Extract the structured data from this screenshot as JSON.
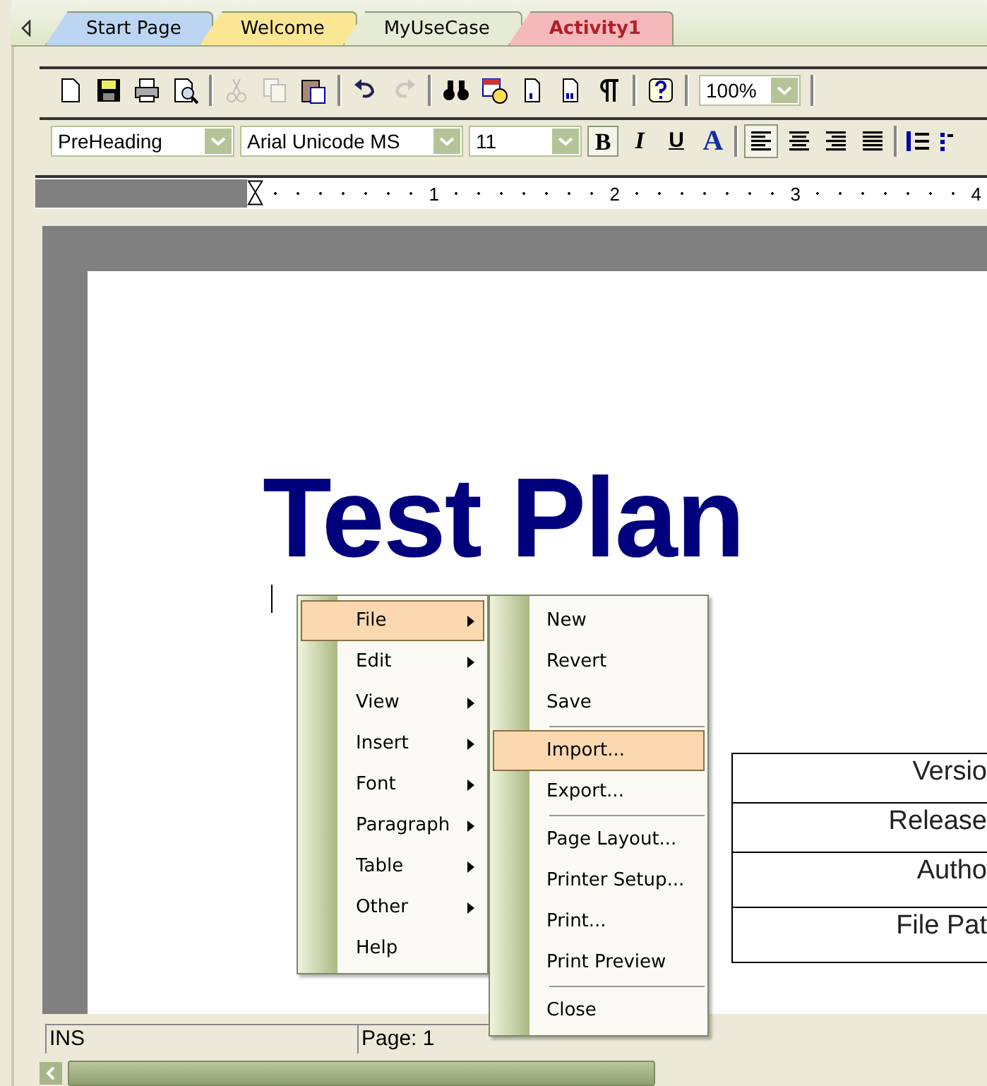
{
  "tabs": [
    {
      "label": "Start Page",
      "selected": false,
      "color": "#bcd5f2"
    },
    {
      "label": "Welcome",
      "selected": false,
      "color": "#fbe694"
    },
    {
      "label": "MyUseCase",
      "selected": false,
      "color": "#e6ebd6"
    },
    {
      "label": "Activity1",
      "selected": true,
      "color": "#f5b9bc"
    }
  ],
  "toolbar": {
    "buttons": [
      {
        "disabled": false
      },
      {
        "disabled": false
      },
      {
        "disabled": false
      },
      {
        "disabled": false
      },
      {
        "disabled": true
      },
      {
        "disabled": true
      },
      {
        "disabled": false
      },
      {
        "disabled": false
      },
      {
        "disabled": true
      },
      {
        "disabled": false
      },
      {
        "disabled": false
      },
      {
        "disabled": false
      },
      {
        "disabled": false
      },
      {
        "disabled": false
      },
      {
        "disabled": false
      }
    ],
    "zoom": "100%"
  },
  "format_bar": {
    "style": "PreHeading",
    "font": "Arial Unicode MS",
    "size": "11",
    "text_buttons": [
      {
        "label": "B",
        "selected": true
      },
      {
        "label": "I",
        "selected": false
      },
      {
        "label": "U",
        "selected": false
      },
      {
        "label": "A",
        "selected": false
      }
    ],
    "align_buttons": [
      {
        "selected": true
      },
      {
        "selected": false
      },
      {
        "selected": false
      },
      {
        "selected": false
      }
    ]
  },
  "ruler": {
    "marks": [
      "1",
      "2",
      "3",
      "4"
    ]
  },
  "document": {
    "title": "Test Plan",
    "table_rows": [
      "Versio",
      "Release",
      "Autho",
      "File Pat"
    ]
  },
  "context_menu": {
    "items": [
      {
        "label": "File",
        "submenu": true,
        "selected": true
      },
      {
        "label": "Edit",
        "submenu": true,
        "selected": false
      },
      {
        "label": "View",
        "submenu": true,
        "selected": false
      },
      {
        "label": "Insert",
        "submenu": true,
        "selected": false
      },
      {
        "label": "Font",
        "submenu": true,
        "selected": false
      },
      {
        "label": "Paragraph",
        "submenu": true,
        "selected": false
      },
      {
        "label": "Table",
        "submenu": true,
        "selected": false
      },
      {
        "label": "Other",
        "submenu": true,
        "selected": false
      },
      {
        "label": "Help",
        "submenu": false,
        "selected": false
      }
    ]
  },
  "submenu": {
    "items": [
      {
        "kind": "item",
        "label": "New",
        "selected": false
      },
      {
        "kind": "item",
        "label": "Revert",
        "selected": false
      },
      {
        "kind": "item",
        "label": "Save",
        "selected": false
      },
      {
        "kind": "separator"
      },
      {
        "kind": "item",
        "label": "Import...",
        "selected": true
      },
      {
        "kind": "item",
        "label": "Export...",
        "selected": false
      },
      {
        "kind": "separator"
      },
      {
        "kind": "item",
        "label": "Page Layout...",
        "selected": false
      },
      {
        "kind": "item",
        "label": "Printer Setup...",
        "selected": false
      },
      {
        "kind": "item",
        "label": "Print...",
        "selected": false
      },
      {
        "kind": "item",
        "label": "Print Preview",
        "selected": false
      },
      {
        "kind": "separator"
      },
      {
        "kind": "item",
        "label": "Close",
        "selected": false
      }
    ]
  },
  "status_bar": {
    "mode": "INS",
    "page": "Page: 1"
  }
}
